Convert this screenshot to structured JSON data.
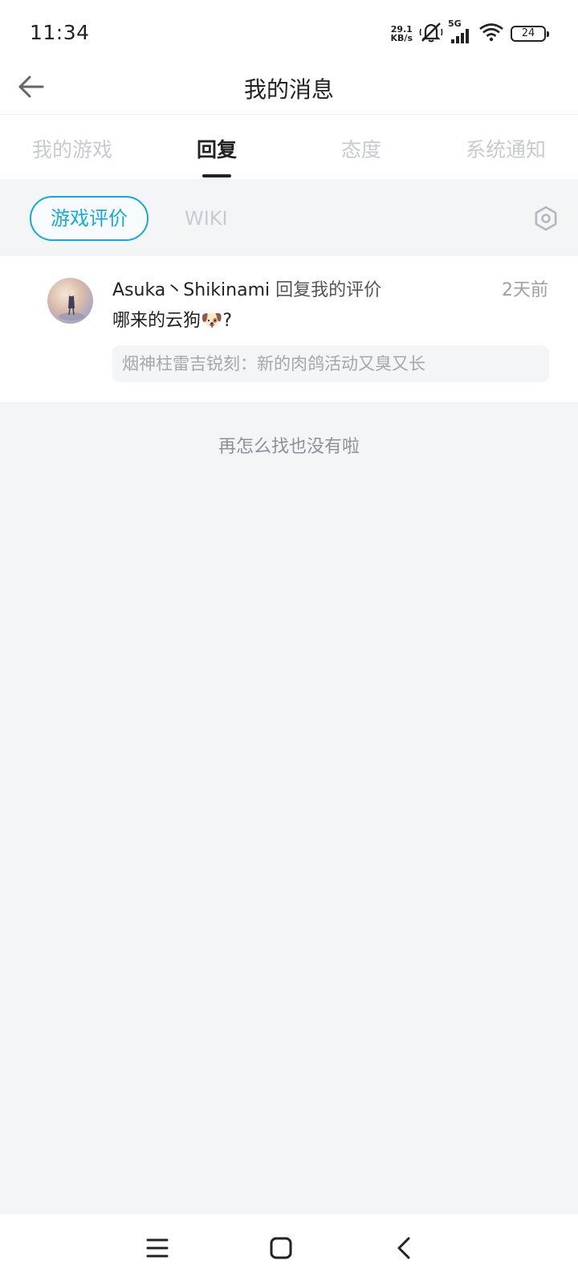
{
  "status_bar": {
    "time": "11:34",
    "net_speed_value": "29.1",
    "net_speed_unit": "KB/s",
    "network": "5G",
    "battery": "24",
    "icons": [
      "mute-icon",
      "signal-icon",
      "wifi-icon",
      "battery-icon"
    ]
  },
  "header": {
    "title": "我的消息",
    "back_icon": "arrow-left-icon"
  },
  "tabs": [
    {
      "label": "我的游戏",
      "active": false
    },
    {
      "label": "回复",
      "active": true
    },
    {
      "label": "态度",
      "active": false
    },
    {
      "label": "系统通知",
      "active": false
    }
  ],
  "filters": {
    "items": [
      {
        "label": "游戏评价",
        "active": true
      },
      {
        "label": "WIKI",
        "active": false
      }
    ],
    "settings_icon": "hex-settings-icon"
  },
  "messages": [
    {
      "author": "Asuka丶Shikinami",
      "action": " 回复我的评价",
      "time": "2天前",
      "body": "哪来的云狗🐶?",
      "quote": "烟神柱雷吉锐刻：新的肉鸽活动又臭又长"
    }
  ],
  "end_hint": "再怎么找也没有啦",
  "nav_bar": {
    "icons": [
      "menu-icon",
      "home-icon",
      "back-icon"
    ]
  },
  "colors": {
    "accent": "#17a9d8",
    "tab_inactive": "#c7cbd1",
    "background": "#f4f5f7"
  }
}
